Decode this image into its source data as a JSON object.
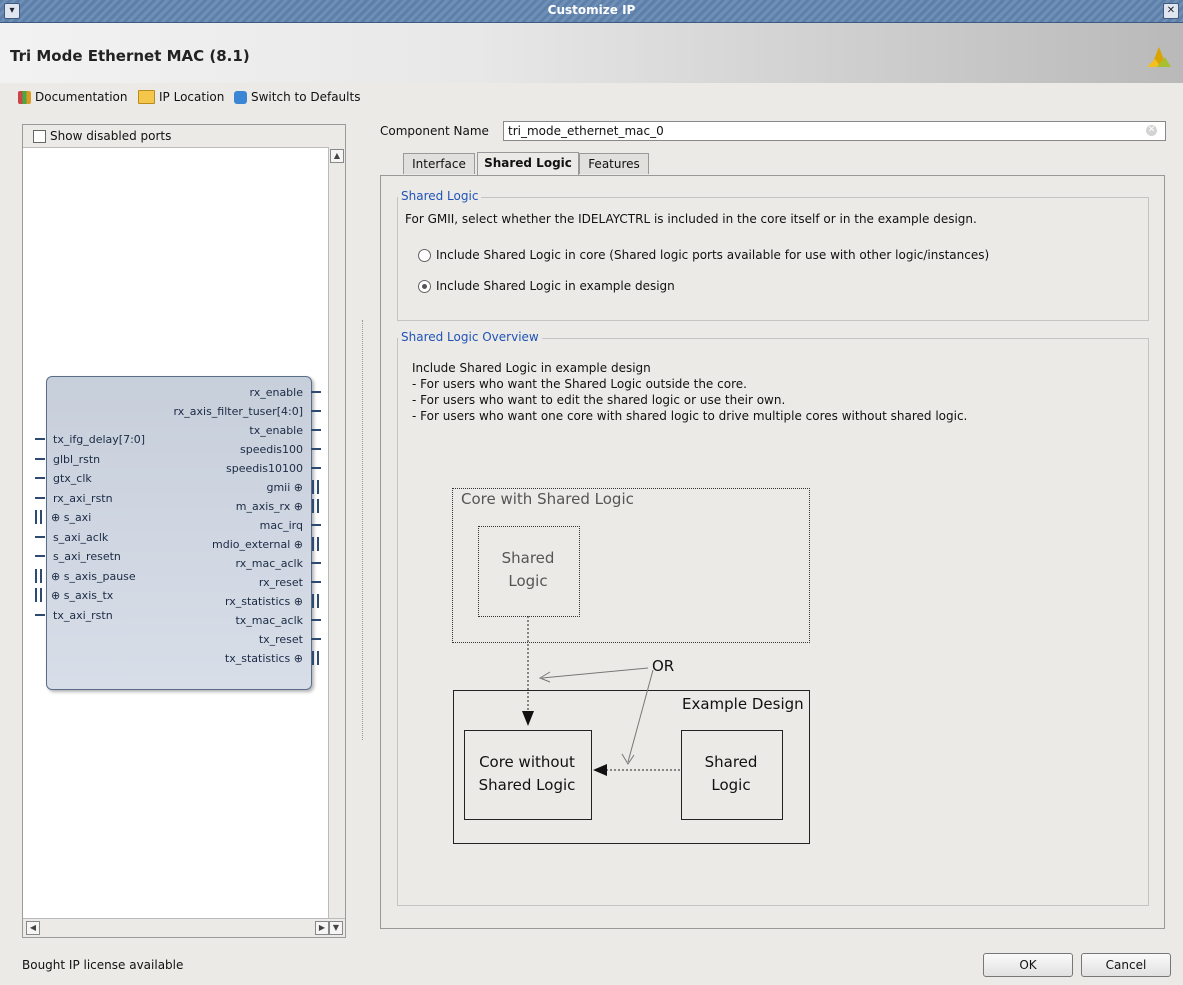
{
  "window": {
    "title": "Customize IP"
  },
  "header": {
    "title": "Tri Mode Ethernet MAC (8.1)"
  },
  "toolbar": {
    "documentation": "Documentation",
    "ip_location": "IP Location",
    "switch_defaults": "Switch to Defaults"
  },
  "left_panel": {
    "show_disabled_ports": "Show disabled ports",
    "left_ports": [
      "tx_ifg_delay[7:0]",
      "glbl_rstn",
      "gtx_clk",
      "rx_axi_rstn",
      "s_axi",
      "s_axi_aclk",
      "s_axi_resetn",
      "s_axis_pause",
      "s_axis_tx",
      "tx_axi_rstn"
    ],
    "right_ports": [
      "rx_enable",
      "rx_axis_filter_tuser[4:0]",
      "tx_enable",
      "speedis100",
      "speedis10100",
      "gmii",
      "m_axis_rx",
      "mac_irq",
      "mdio_external",
      "rx_mac_aclk",
      "rx_reset",
      "rx_statistics",
      "tx_mac_aclk",
      "tx_reset",
      "tx_statistics"
    ]
  },
  "component": {
    "label": "Component Name",
    "value": "tri_mode_ethernet_mac_0"
  },
  "tabs": [
    "Interface",
    "Shared Logic",
    "Features"
  ],
  "active_tab": "Shared Logic",
  "shared_logic": {
    "group_title": "Shared Logic",
    "description": "For GMII, select whether the IDELAYCTRL is included in the core itself or in the example design.",
    "option_core": "Include Shared Logic in core (Shared logic ports available for use with other logic/instances)",
    "option_example": "Include Shared Logic in example design",
    "selected": "option_example"
  },
  "overview": {
    "group_title": "Shared Logic Overview",
    "lines": [
      "Include Shared Logic in example design",
      "- For users who want the Shared Logic outside the core.",
      "- For users who want to edit the shared logic or use their own.",
      "- For users who want one core with shared logic to drive multiple cores without shared logic."
    ],
    "diagram": {
      "core_with_shared": "Core with Shared Logic",
      "shared_logic_1": "Shared\nLogic",
      "or": "OR",
      "example_design": "Example Design",
      "core_without": "Core without\nShared Logic",
      "shared_logic_2": "Shared\nLogic"
    }
  },
  "status": {
    "text": "Bought IP license available"
  },
  "buttons": {
    "ok": "OK",
    "cancel": "Cancel"
  }
}
